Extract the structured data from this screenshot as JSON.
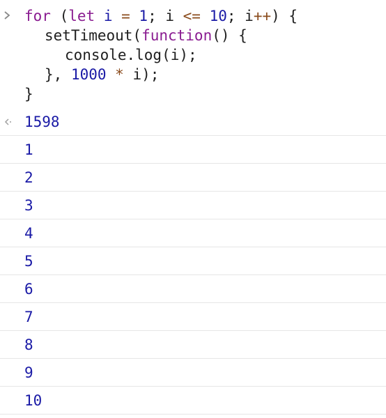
{
  "input": {
    "prompt_icon": "chevron-right-icon",
    "line1": {
      "kw_for": "for",
      "open_paren": " (",
      "kw_let": "let",
      "var_i": " i ",
      "eq": "=",
      "num_1": " 1",
      "semi1": "; i ",
      "lte": "<=",
      "num_10": " 10",
      "semi2": "; i",
      "incr": "++",
      "close": ") {"
    },
    "line2": {
      "call": "setTimeout(",
      "kw_function": "function",
      "rest": "() {"
    },
    "line3": {
      "text": "console.log(i);"
    },
    "line4": {
      "close": "}, ",
      "num_1000": "1000",
      "mult": " * ",
      "rest": "i);"
    },
    "line5": {
      "text": "}"
    }
  },
  "result": {
    "return_icon": "return-arrow-icon",
    "value": "1598"
  },
  "logs": [
    "1",
    "2",
    "3",
    "4",
    "5",
    "6",
    "7",
    "8",
    "9",
    "10"
  ],
  "colors": {
    "keyword": "#8a1c91",
    "number": "#1a1aa6",
    "operator": "#8a4b1c",
    "divider": "#e6e6e6"
  }
}
